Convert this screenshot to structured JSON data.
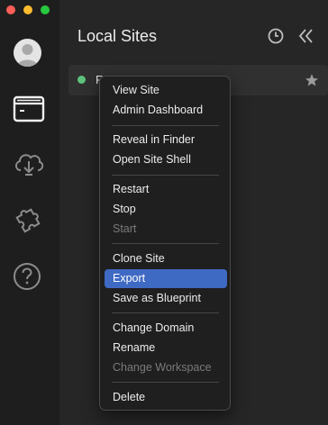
{
  "window": {
    "traffic_lights": [
      {
        "name": "close",
        "color": "#ff5f57"
      },
      {
        "name": "minimize",
        "color": "#febc2e"
      },
      {
        "name": "zoom",
        "color": "#28c840"
      }
    ]
  },
  "rail": {
    "items": [
      {
        "name": "avatar"
      },
      {
        "name": "local-sites-icon"
      },
      {
        "name": "connect-cloud-icon"
      },
      {
        "name": "add-ons-puzzle-icon"
      },
      {
        "name": "help-icon"
      }
    ]
  },
  "header": {
    "title": "Local Sites",
    "icons": [
      "history-clock-icon",
      "collapse-double-chevron-icon"
    ]
  },
  "site": {
    "name": "F",
    "status": "running",
    "status_color": "#5ec27d",
    "favorited": false
  },
  "context_menu": {
    "active_item": "Export",
    "accent": "#3f6ac3",
    "items": [
      {
        "label": "View Site",
        "enabled": true
      },
      {
        "label": "Admin Dashboard",
        "enabled": true
      },
      {
        "label": "Reveal in Finder",
        "enabled": true
      },
      {
        "label": "Open Site Shell",
        "enabled": true
      },
      {
        "label": "Restart",
        "enabled": true
      },
      {
        "label": "Stop",
        "enabled": true
      },
      {
        "label": "Start",
        "enabled": false
      },
      {
        "label": "Clone Site",
        "enabled": true
      },
      {
        "label": "Export",
        "enabled": true
      },
      {
        "label": "Save as Blueprint",
        "enabled": true
      },
      {
        "label": "Change Domain",
        "enabled": true
      },
      {
        "label": "Rename",
        "enabled": true
      },
      {
        "label": "Change Workspace",
        "enabled": false
      },
      {
        "label": "Delete",
        "enabled": true
      }
    ]
  }
}
